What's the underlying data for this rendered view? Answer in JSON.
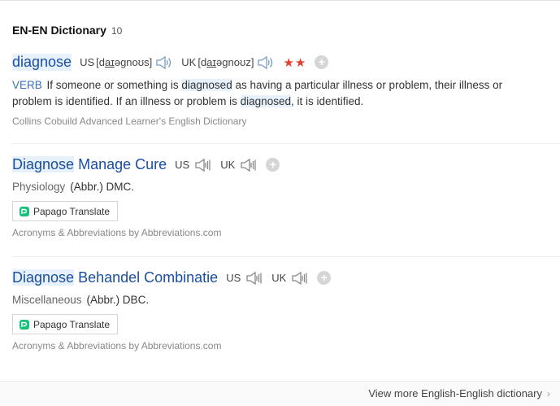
{
  "section": {
    "title": "EN-EN Dictionary",
    "count": "10"
  },
  "entries": [
    {
      "word": "diagnose",
      "us_label": "US",
      "us_ipa_pre": "[d",
      "us_ipa_u": "aɪ",
      "us_ipa_post": "əgnoʊs]",
      "uk_label": "UK",
      "uk_ipa_pre": "[d",
      "uk_ipa_u": "aɪ",
      "uk_ipa_post": "əgnoʊz]",
      "stars": "★★",
      "pos": "VERB",
      "def_1": "If someone or something is",
      "def_hl_1": "diagnosed",
      "def_2": "as having a particular illness or problem, their illness or problem is identified. If an illness or problem is",
      "def_hl_2": "diagnosed",
      "def_3": ", it is identified.",
      "source": "Collins Cobuild Advanced Learner's English Dictionary"
    },
    {
      "word_hl": "Diagnose",
      "word_rest": "Manage Cure",
      "us_label": "US",
      "uk_label": "UK",
      "category": "Physiology",
      "abbr": "(Abbr.) DMC.",
      "translate": "Papago Translate",
      "source": "Acronyms & Abbreviations by Abbreviations.com"
    },
    {
      "word_hl": "Diagnose",
      "word_rest": "Behandel Combinatie",
      "us_label": "US",
      "uk_label": "UK",
      "category": "Miscellaneous",
      "abbr": "(Abbr.) DBC.",
      "translate": "Papago Translate",
      "source": "Acronyms & Abbreviations by Abbreviations.com"
    }
  ],
  "footer": {
    "more_link": "View more English-English dictionary",
    "chevron": "›"
  },
  "icons": {
    "speaker": "speaker-icon",
    "plus": "plus-icon",
    "papago": "papago-icon",
    "chevron": "chevron-right-icon"
  },
  "colors": {
    "headword": "#1a4fa0",
    "highlight": "#e7f1fb",
    "pos": "#3b72b5",
    "stars": "#e2402e"
  }
}
